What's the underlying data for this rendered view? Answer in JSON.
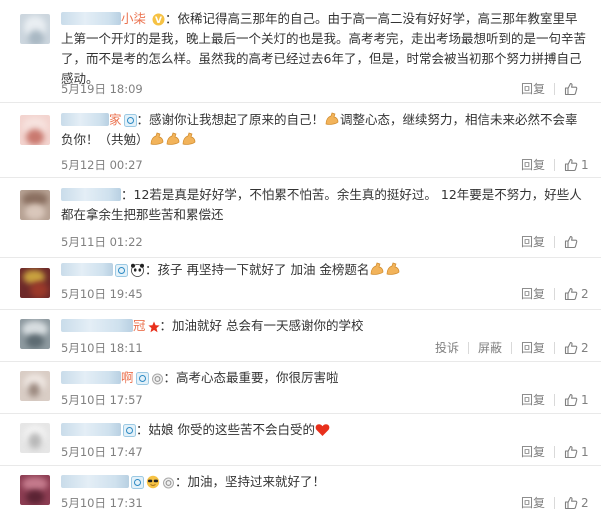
{
  "comments": [
    {
      "name": "小柒",
      "badge": "V",
      "text": "依稀记得高三那年的自己。由于高一高二没有好好学，高三那年教室里早上第一个开灯的是我，晚上最后一个关灯的也是我。高考考完，走出考场最想听到的是一句辛苦了，而不是考的怎么样。虽然我的高考已经过去6年了，但是，时常会被当初那个努力拼搏自己感动。",
      "time": "5月19日 18:09",
      "reply": "回复",
      "likes": ""
    },
    {
      "name": "家",
      "text": "感谢你让我想起了原来的自己！",
      "text2": "调整心态，继续努力，相信未来必然不会辜负你！（共勉）",
      "time": "5月12日 00:27",
      "reply": "回复",
      "likes": "1"
    },
    {
      "name": "",
      "text": "12若是真是好好学，不怕累不怕苦。余生真的挺好过。 12年要是不努力，好些人都在拿余生把那些苦和累偿还",
      "time": "5月11日 01:22",
      "reply": "回复",
      "likes": ""
    },
    {
      "name": "",
      "text": "孩子 再坚持一下就好了 加油 金榜题名",
      "time": "5月10日 19:45",
      "reply": "回复",
      "likes": "2"
    },
    {
      "name": "冠",
      "text": "加油就好 总会有一天感谢你的学校",
      "time": "5月10日 18:11",
      "report": "投诉",
      "block": "屏蔽",
      "reply": "回复",
      "likes": "2"
    },
    {
      "name": "啊",
      "text": "高考心态最重要，你很厉害啦",
      "time": "5月10日 17:57",
      "reply": "回复",
      "likes": "1"
    },
    {
      "name": "",
      "text": "姑娘 你受的这些苦不会白受的",
      "time": "5月10日 17:47",
      "reply": "回复",
      "likes": "1"
    },
    {
      "name": "",
      "text": "加油，坚持过来就好了！",
      "time": "5月10日 17:31",
      "reply": "回复",
      "likes": "2"
    }
  ],
  "colors": {
    "text": "#333333",
    "meta": "#808080",
    "divider": "#e9e9e9",
    "name_highlight": "#eb7350",
    "vip_gold": "#f6c244"
  },
  "icons": [
    "like-thumb-icon",
    "muscle-emoji",
    "panda-emoji",
    "red-star-icon",
    "eye-badge-icon",
    "medal-badge-icon",
    "heart-emoji",
    "sunglasses-emoji"
  ]
}
